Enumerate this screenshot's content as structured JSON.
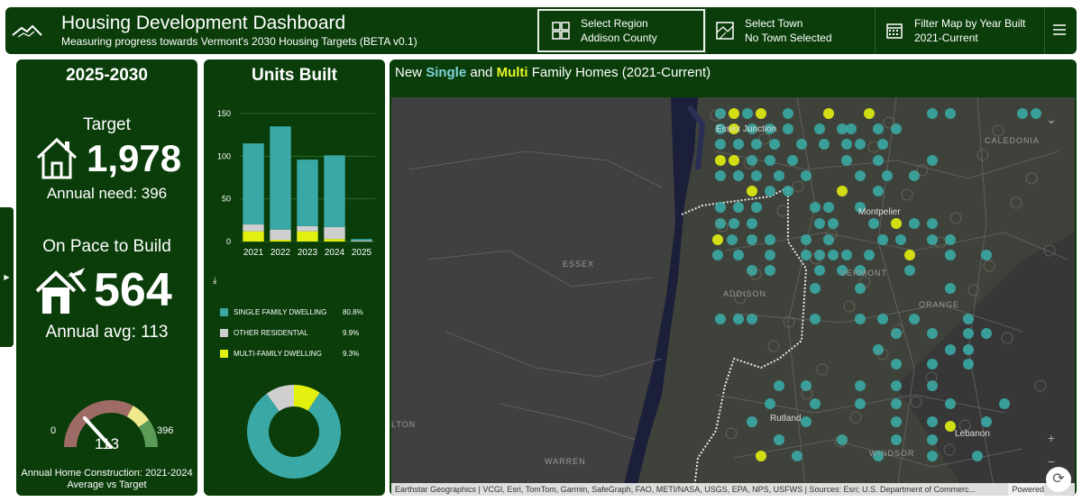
{
  "header": {
    "title": "Housing Development Dashboard",
    "subtitle": "Measuring progress towards Vermont's 2030 Housing Targets (BETA v0.1)",
    "region_label": "Select Region",
    "region_value": "Addison County",
    "town_label": "Select Town",
    "town_value": "No Town Selected",
    "year_label": "Filter Map by Year Built",
    "year_value": "2021-Current"
  },
  "targets_panel": {
    "period": "2025-2030",
    "target_label": "Target",
    "target_value": "1,978",
    "annual_need": "Annual need: 396",
    "onpace_label": "On Pace to Build",
    "onpace_value": "564",
    "annual_avg": "Annual avg: 113",
    "gauge_min": "0",
    "gauge_max": "396",
    "gauge_value": "113",
    "gauge_caption": "Annual Home Construction: 2021-2024 Average vs Target"
  },
  "units_panel": {
    "title": "Units Built",
    "download_icon": "download-icon"
  },
  "chart_data": [
    {
      "type": "bar",
      "stacked": true,
      "categories": [
        "2021",
        "2022",
        "2023",
        "2024",
        "2025"
      ],
      "series": [
        {
          "name": "MULTI-FAMILY DWELLING",
          "values": [
            12,
            2,
            12,
            3,
            0
          ],
          "color": "#e2f00f"
        },
        {
          "name": "OTHER RESIDENTIAL",
          "values": [
            8,
            12,
            6,
            14,
            1
          ],
          "color": "#cfcfcf"
        },
        {
          "name": "SINGLE FAMILY DWELLING",
          "values": [
            95,
            121,
            78,
            84,
            2
          ],
          "color": "#3aa8a4"
        }
      ],
      "yticks": [
        0,
        50,
        100,
        150
      ],
      "ylim": [
        0,
        150
      ],
      "grid": true
    },
    {
      "type": "pie",
      "donut": true,
      "slices": [
        {
          "label": "SINGLE FAMILY DWELLING",
          "value": 80.8,
          "display": "80.8%",
          "color": "#3aa8a4"
        },
        {
          "label": "OTHER RESIDENTIAL",
          "value": 9.9,
          "display": "9.9%",
          "color": "#cfcfcf"
        },
        {
          "label": "MULTI-FAMILY DWELLING",
          "value": 9.3,
          "display": "9.3%",
          "color": "#e2f00f"
        }
      ]
    }
  ],
  "map": {
    "title_prefix": "New",
    "title_single": "Single",
    "title_and": "and",
    "title_multi": "Multi",
    "title_suffix": "Family Homes (2021-Current)",
    "labels": [
      "ESSEX",
      "ADDISON",
      "VERMONT",
      "ORANGE",
      "CALEDONIA",
      "WINDSOR",
      "WARREN",
      "LTON"
    ],
    "cities": [
      "Essex Junction",
      "Montpelier",
      "Rutland",
      "Lebanon"
    ],
    "attribution": "Earthstar Geographics | VCGI, Esri, TomTom, Garmin, SafeGraph, FAO, METI/NASA, USGS, EPA, NPS, USFWS | Sources: Esri; U.S. Department of Commerc...",
    "powered": "Powered"
  },
  "colors": {
    "panel_bg": "#0a3d0a",
    "single": "#3aa8a4",
    "multi": "#e2f00f",
    "other": "#cfcfcf"
  }
}
